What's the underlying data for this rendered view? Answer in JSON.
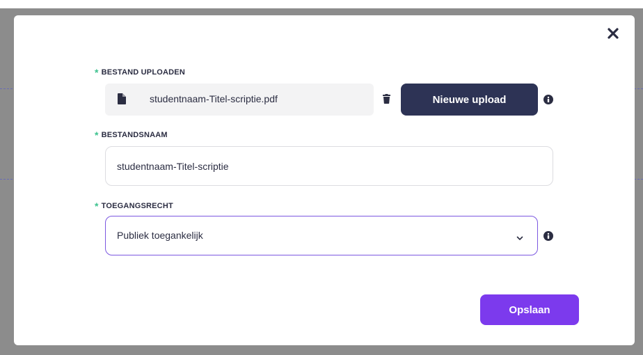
{
  "modal": {
    "close_icon": "close-icon",
    "upload_field": {
      "required_marker": "*",
      "label": "BESTAND UPLOADEN",
      "file_icon": "file-icon",
      "file_name": "studentnaam-Titel-scriptie.pdf",
      "delete_icon": "trash-icon",
      "upload_button_label": "Nieuwe upload",
      "info_icon": "info-icon"
    },
    "filename_field": {
      "required_marker": "*",
      "label": "BESTANDSNAAM",
      "value": "studentnaam-Titel-scriptie"
    },
    "access_field": {
      "required_marker": "*",
      "label": "TOEGANGSRECHT",
      "selected_value": "Publiek toegankelijk",
      "chevron_icon": "chevron-down-icon",
      "info_icon": "info-icon"
    },
    "save_button_label": "Opslaan",
    "colors": {
      "primary_dark": "#2d3355",
      "accent_purple": "#7c3aed",
      "required_green": "#3ec28f",
      "focus_border": "#7b57e0"
    }
  }
}
